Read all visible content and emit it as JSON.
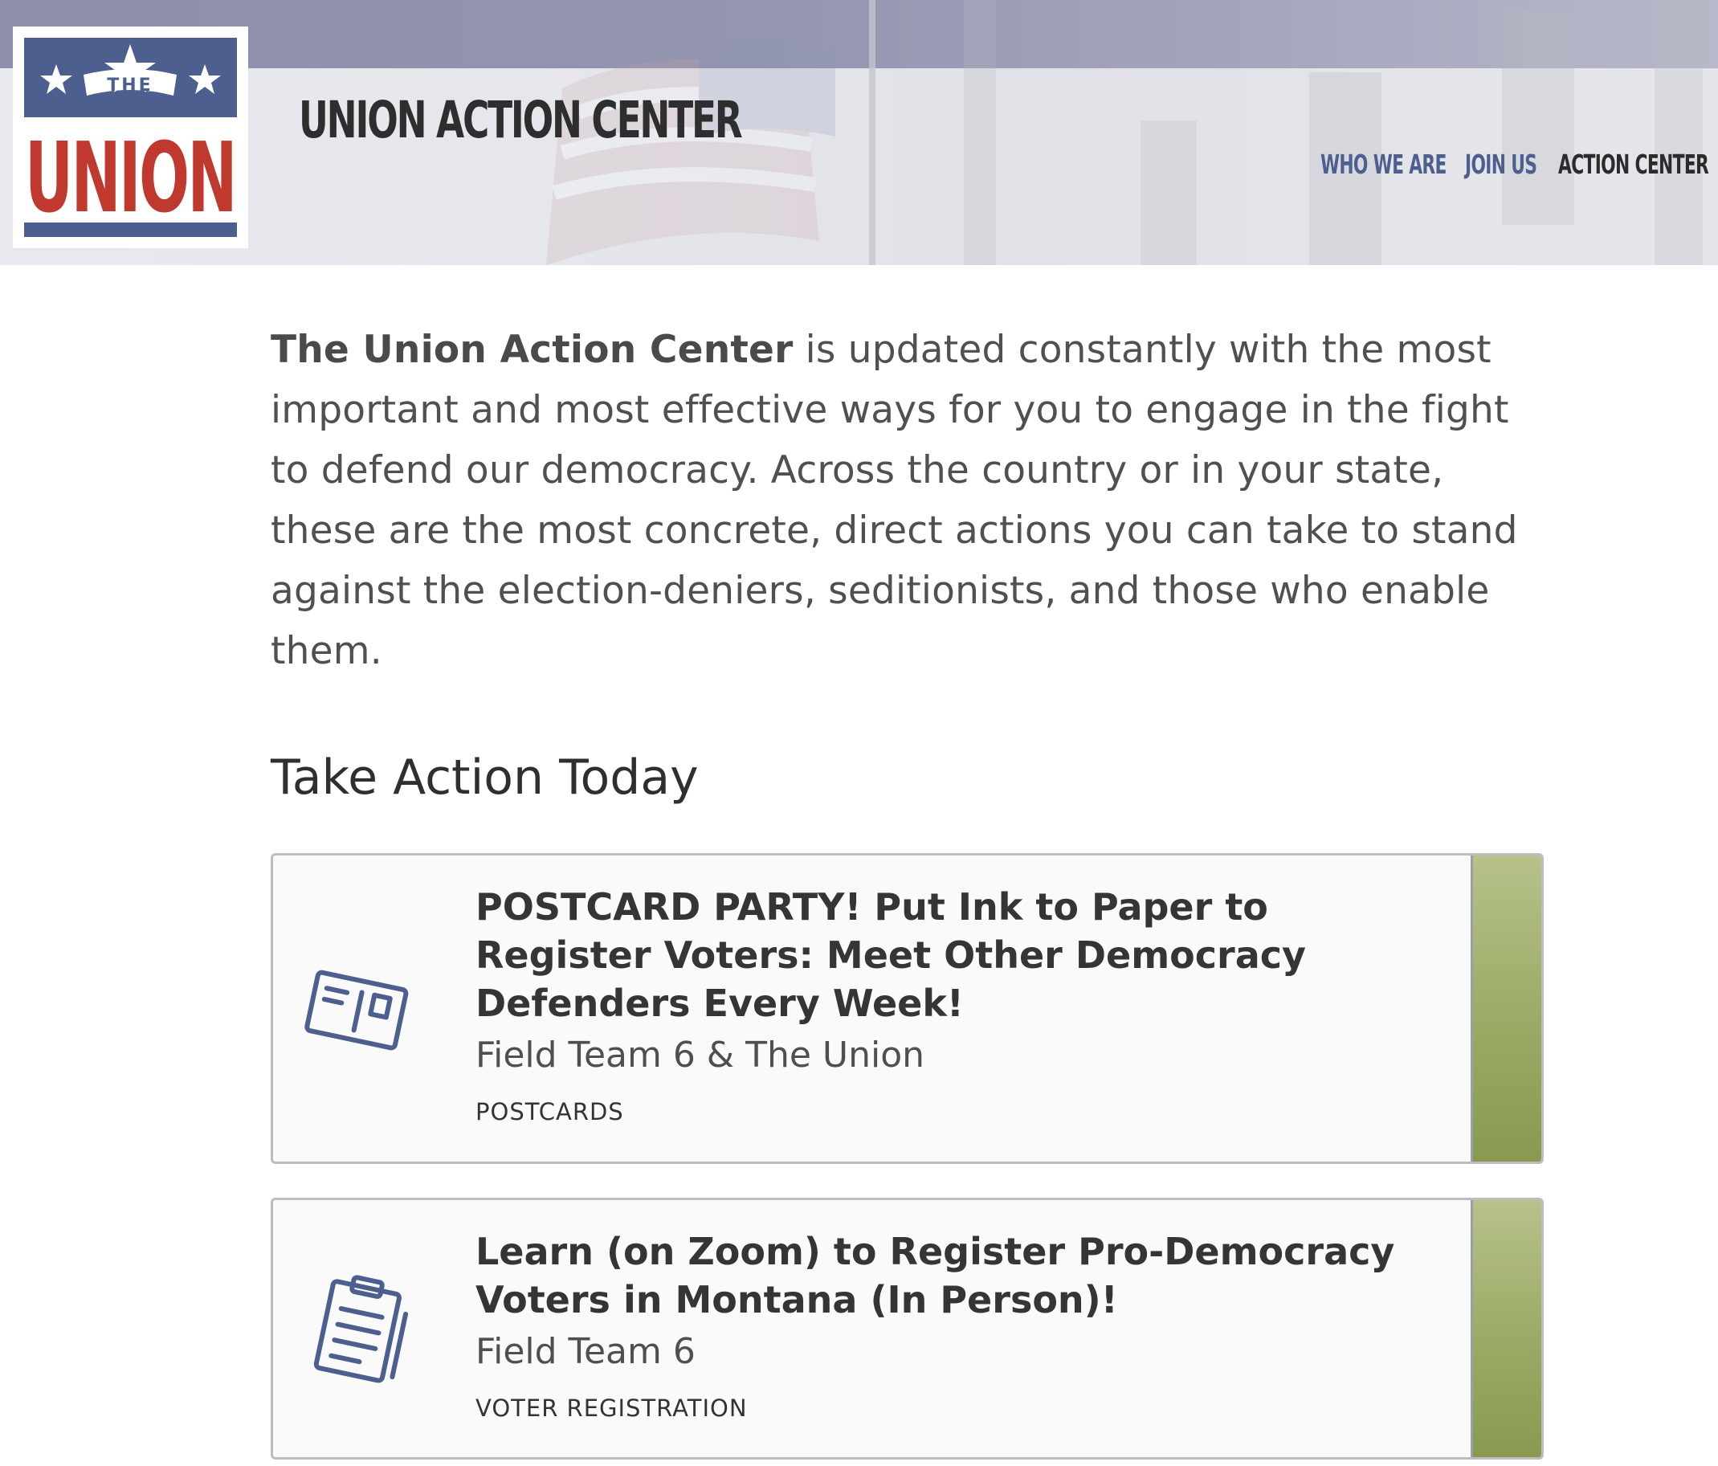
{
  "logo": {
    "the_text": "THE",
    "union_text": "UNION"
  },
  "header": {
    "site_title": "UNION ACTION CENTER"
  },
  "nav": {
    "items": [
      {
        "label": "WHO WE ARE",
        "active": false
      },
      {
        "label": "JOIN US",
        "active": false
      },
      {
        "label": "ACTION CENTER",
        "active": true
      }
    ]
  },
  "intro": {
    "bold_lead": "The Union Action Center",
    "text": " is updated constantly with the most important and most effective ways for you to engage in the fight to defend our democracy. Across the country or in your state, these are the most concrete, direct actions you can take to stand against the election-deniers, seditionists, and those who enable them."
  },
  "section": {
    "heading": "Take Action Today"
  },
  "actions": [
    {
      "icon": "postcard-icon",
      "title": "POSTCARD PARTY! Put Ink to Paper to Register Voters: Meet Other Democracy Defenders Every Week!",
      "org": "Field Team 6 & The Union",
      "tag": "POSTCARDS"
    },
    {
      "icon": "clipboard-icon",
      "title": "Learn (on Zoom) to Register Pro-Democracy Voters in Montana (In Person)!",
      "org": "Field Team 6",
      "tag": "VOTER REGISTRATION"
    }
  ],
  "colors": {
    "brand_blue": "#4d5f8e",
    "brand_red": "#c0392f",
    "accent_green": "#9dac68",
    "text_dark": "#353535"
  }
}
